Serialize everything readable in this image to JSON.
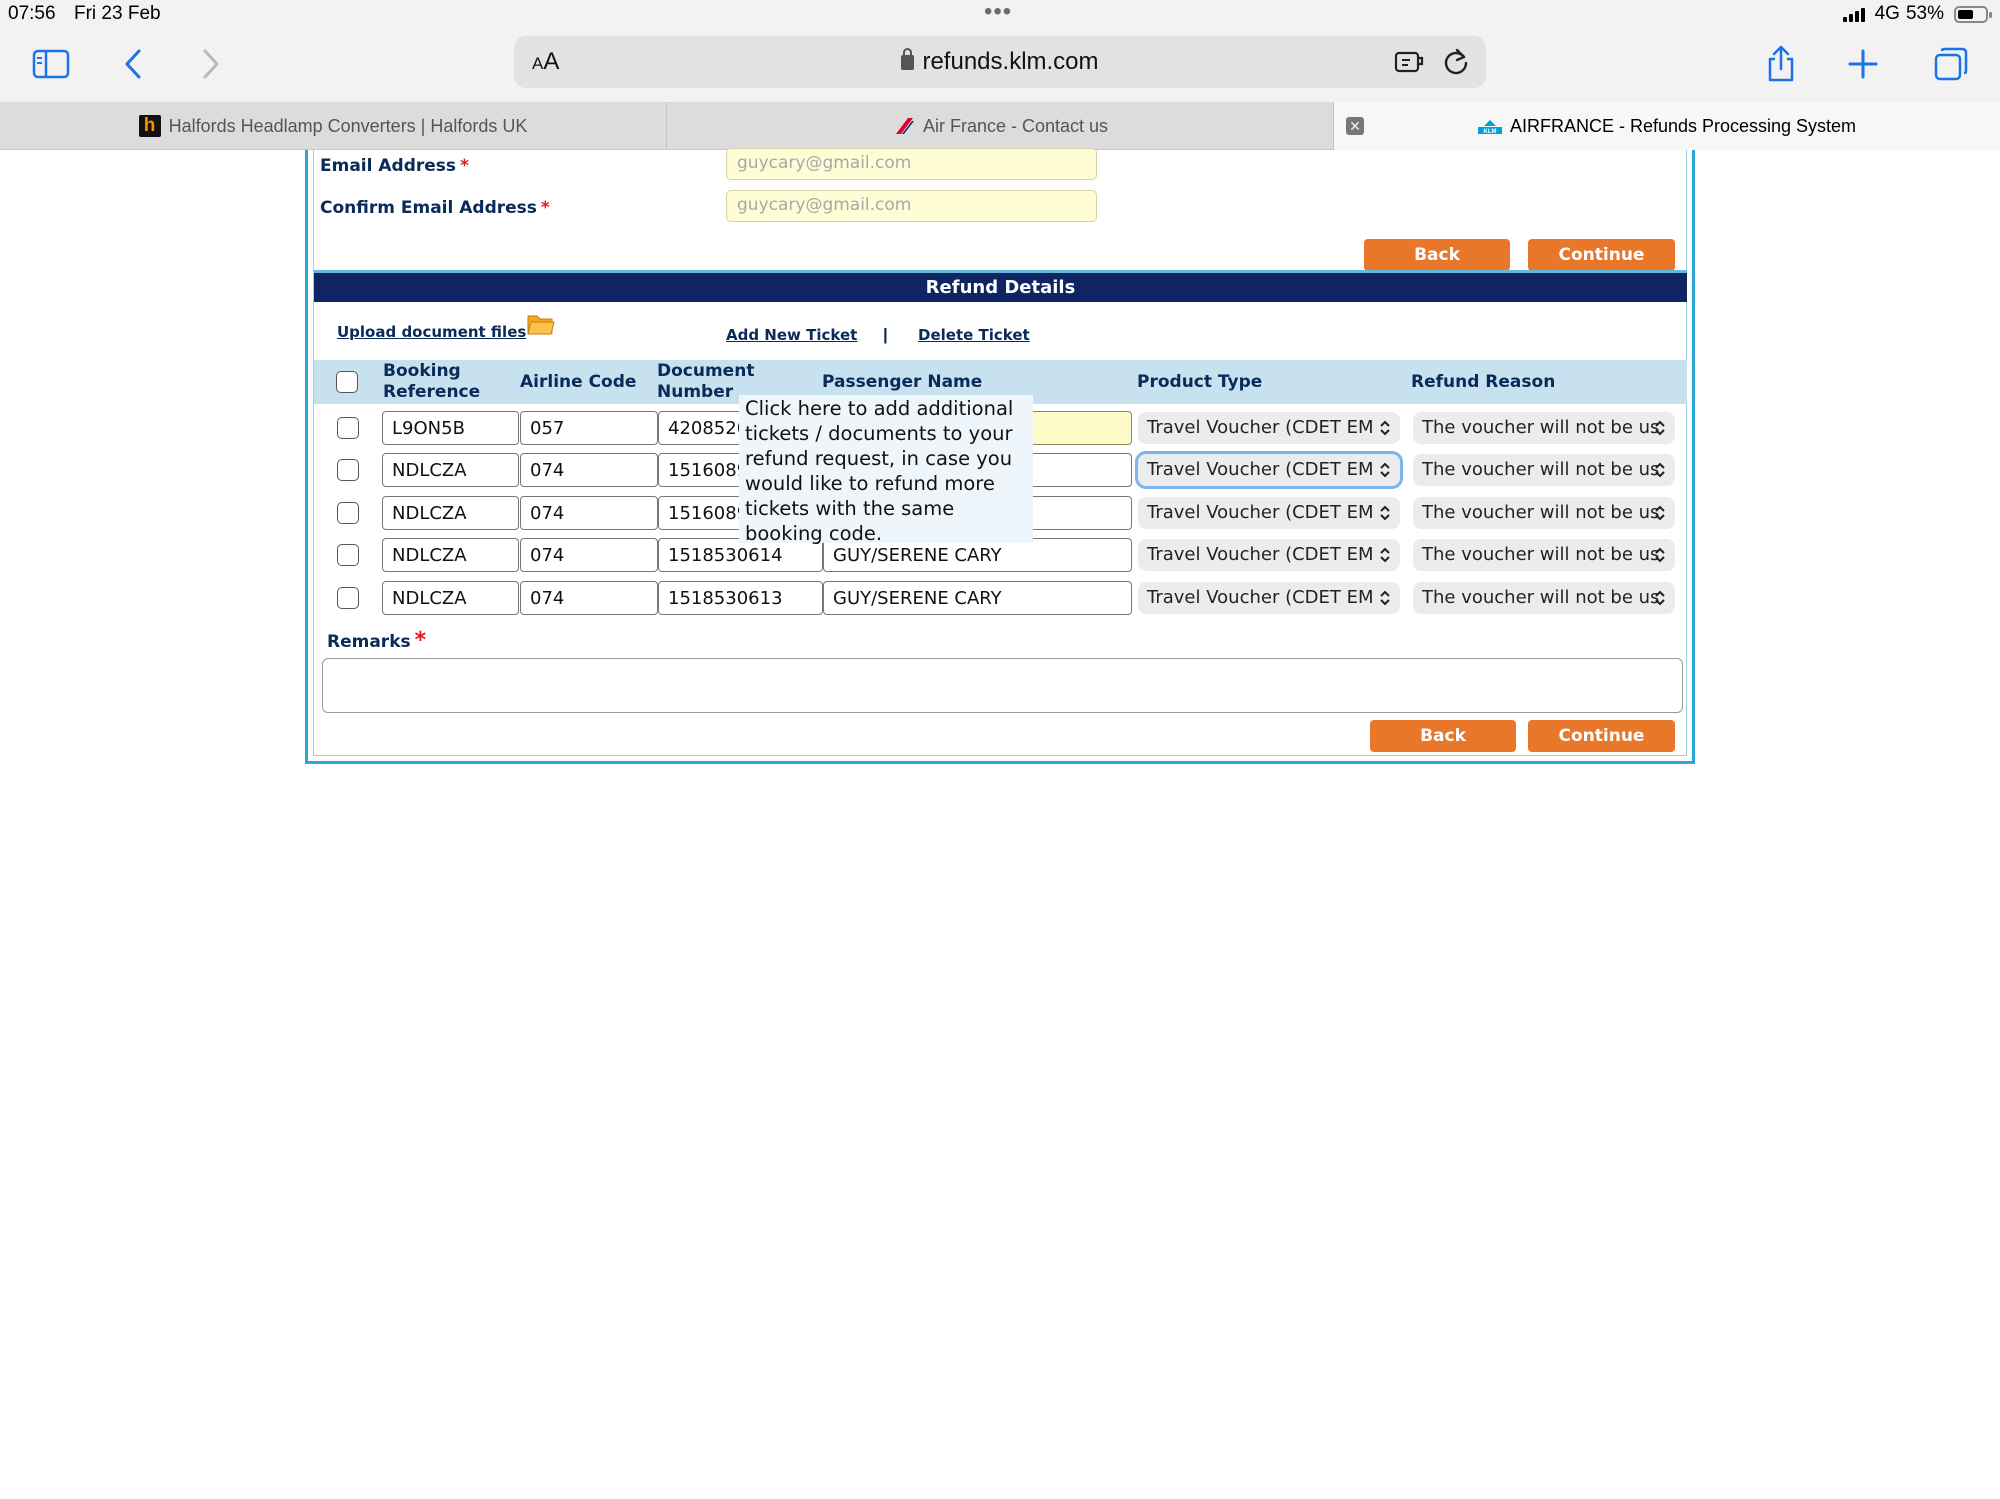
{
  "status": {
    "time": "07:56",
    "date": "Fri 23 Feb",
    "network": "4G",
    "battery": "53%"
  },
  "browser": {
    "text_size": "AA",
    "url": "refunds.klm.com",
    "tabs": [
      {
        "title": "Halfords Headlamp Converters | Halfords UK",
        "icon": "halfords-favicon"
      },
      {
        "title": "Air France - Contact us",
        "icon": "airfrance-favicon"
      },
      {
        "title": "AIRFRANCE - Refunds Processing System",
        "icon": "klm-favicon",
        "active": true
      }
    ]
  },
  "contact": {
    "email_label": "Email Address",
    "email_value": "guycary@gmail.com",
    "confirm_label": "Confirm Email Address",
    "confirm_value": "guycary@gmail.com",
    "required_mark": "*"
  },
  "buttons": {
    "back": "Back",
    "continue": "Continue"
  },
  "refund": {
    "section_title": "Refund Details",
    "upload_link": "Upload document files",
    "add_ticket_link": "Add New Ticket",
    "separator": "|",
    "delete_ticket_link": "Delete Ticket",
    "columns": {
      "booking_line1": "Booking",
      "booking_line2": "Reference",
      "airline": "Airline Code",
      "document_line1": "Document",
      "document_line2": "Number",
      "passenger": "Passenger Name",
      "product": "Product Type",
      "reason": "Refund Reason"
    },
    "rows": [
      {
        "booking": "L9ON5B",
        "airline": "057",
        "document": "4208520",
        "passenger": "",
        "product": "Travel Voucher (CDET EM",
        "reason": "The voucher will not be us"
      },
      {
        "booking": "NDLCZA",
        "airline": "074",
        "document": "1516089",
        "passenger": "",
        "product": "Travel Voucher (CDET EM",
        "reason": "The voucher will not be us"
      },
      {
        "booking": "NDLCZA",
        "airline": "074",
        "document": "1516089",
        "passenger": "",
        "product": "Travel Voucher (CDET EM",
        "reason": "The voucher will not be us"
      },
      {
        "booking": "NDLCZA",
        "airline": "074",
        "document": "1518530614",
        "passenger": "GUY/SERENE CARY",
        "product": "Travel Voucher (CDET EM",
        "reason": "The voucher will not be us"
      },
      {
        "booking": "NDLCZA",
        "airline": "074",
        "document": "1518530613",
        "passenger": "GUY/SERENE CARY",
        "product": "Travel Voucher (CDET EM",
        "reason": "The voucher will not be us"
      }
    ],
    "remarks_label": "Remarks",
    "remarks_value": "",
    "tooltip": "Click here to add additional tickets / documents to your refund request, in case you would like to refund more tickets with the same booking code."
  },
  "colors": {
    "accent_orange": "#e8772a",
    "header_navy": "#0f2462",
    "frame_blue": "#2aa5d8",
    "table_head": "#c8e1ee",
    "highlight_yellow": "#fffbc8"
  }
}
